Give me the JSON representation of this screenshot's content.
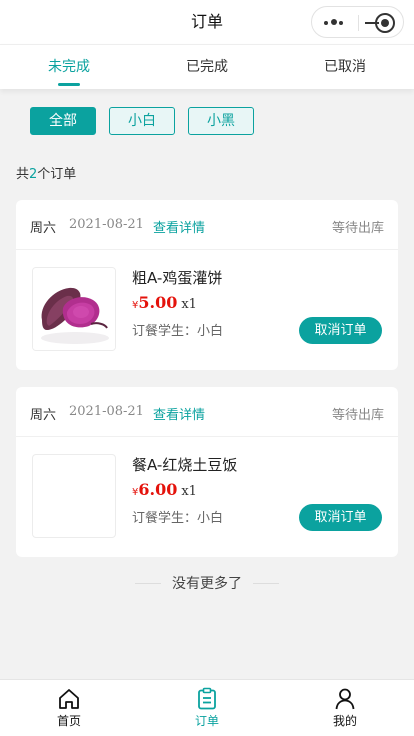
{
  "nav": {
    "title": "订单"
  },
  "tabs": [
    {
      "label": "未完成",
      "active": true
    },
    {
      "label": "已完成",
      "active": false
    },
    {
      "label": "已取消",
      "active": false
    }
  ],
  "filters": [
    {
      "label": "全部",
      "active": true
    },
    {
      "label": "小白",
      "active": false
    },
    {
      "label": "小黑",
      "active": false
    }
  ],
  "summary": {
    "prefix": "共",
    "count": "2",
    "suffix": "个订单"
  },
  "orders": [
    {
      "weekday": "周六",
      "date": "2021-08-21",
      "detail_link": "查看详情",
      "status": "等待出库",
      "item_name": "粗A-鸡蛋灌饼",
      "currency": "¥",
      "price": "5.00",
      "qty": "x1",
      "student": "订餐学生：小白",
      "cancel_label": "取消订单",
      "image": "purple-sweet-potato"
    },
    {
      "weekday": "周六",
      "date": "2021-08-21",
      "detail_link": "查看详情",
      "status": "等待出库",
      "item_name": "餐A-红烧土豆饭",
      "currency": "¥",
      "price": "6.00",
      "qty": "x1",
      "student": "订餐学生：小白",
      "cancel_label": "取消订单",
      "image": "empty"
    }
  ],
  "footer": {
    "no_more": "没有更多了"
  },
  "tabbar": [
    {
      "label": "首页",
      "icon": "home-icon",
      "active": false
    },
    {
      "label": "订单",
      "icon": "order-icon",
      "active": true
    },
    {
      "label": "我的",
      "icon": "user-icon",
      "active": false
    }
  ],
  "colors": {
    "accent": "#0ba29f",
    "price": "#e4120b",
    "background": "#f2f2f2"
  }
}
